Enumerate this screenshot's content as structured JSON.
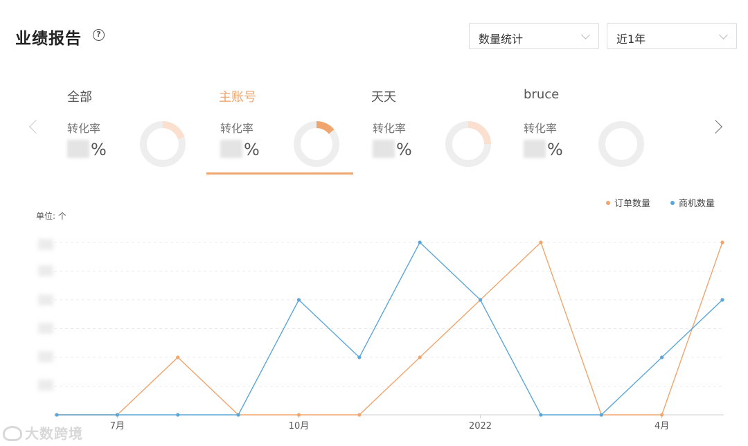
{
  "header": {
    "title": "业绩报告",
    "help_icon": "question-circle-icon",
    "mode_select": {
      "value": "数量统计"
    },
    "range_select": {
      "value": "近1年"
    }
  },
  "accounts": [
    {
      "name": "全部",
      "label": "转化率",
      "pct_visible": "%",
      "rate": 0.2,
      "active": false
    },
    {
      "name": "主账号",
      "label": "转化率",
      "pct_visible": "%",
      "rate": 0.14,
      "active": true
    },
    {
      "name": "天天",
      "label": "转化率",
      "pct_visible": "%",
      "rate": 0.25,
      "active": false
    },
    {
      "name": "bruce",
      "label": "转化率",
      "pct_visible": "%",
      "rate": 0.0,
      "active": false
    }
  ],
  "colors": {
    "accent": "#f0a56e",
    "orders": "#f0a56e",
    "leads": "#5ba6d6",
    "donut_track": "#eeeeee",
    "donut_fill_light": "#fbe0cf"
  },
  "chart_data": {
    "type": "line",
    "unit_label": "单位: 个",
    "x_ticks": [
      {
        "label": "7月",
        "index": 1
      },
      {
        "label": "10月",
        "index": 4
      },
      {
        "label": "2022",
        "index": 7
      },
      {
        "label": "4月",
        "index": 10
      }
    ],
    "x_count": 12,
    "ylim": [
      0,
      3
    ],
    "grid": true,
    "series": [
      {
        "name": "订单数量",
        "values": [
          0,
          0,
          1,
          0,
          0,
          0,
          1,
          2,
          3,
          0,
          0,
          3
        ]
      },
      {
        "name": "商机数量",
        "values": [
          0,
          0,
          0,
          0,
          2,
          1,
          3,
          2,
          0,
          0,
          1,
          2
        ]
      }
    ],
    "legend": "top-right"
  },
  "watermark": "大数跨境"
}
